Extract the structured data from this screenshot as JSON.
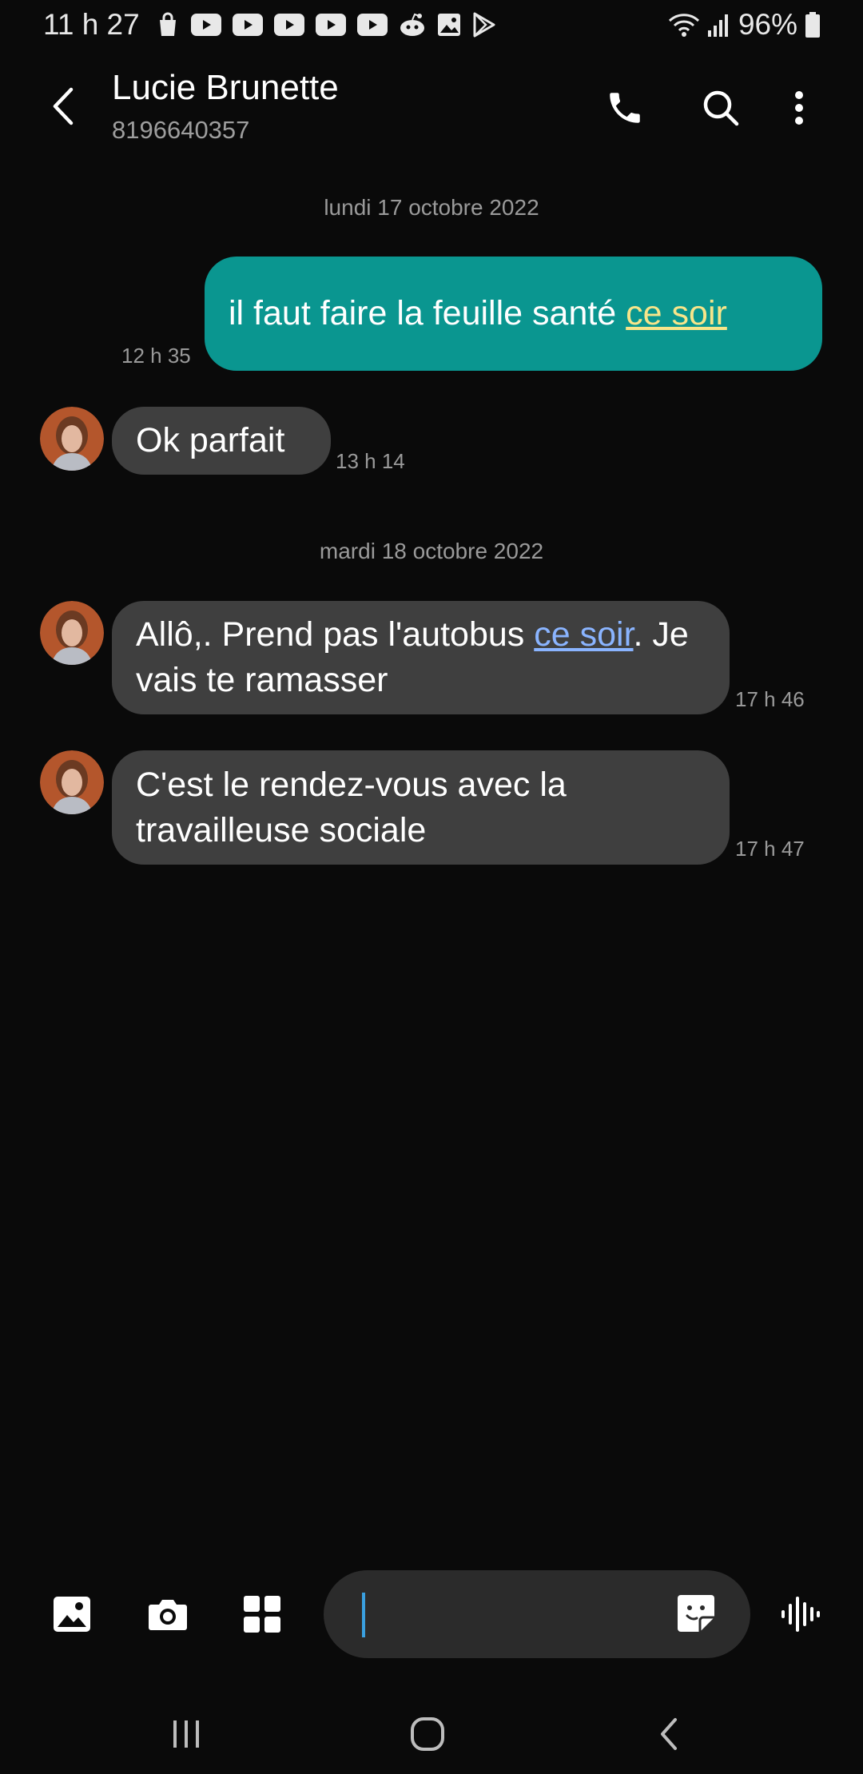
{
  "status_bar": {
    "time": "11 h 27",
    "battery": "96%",
    "notification_icons": [
      "shopping-bag-icon",
      "youtube-icon",
      "youtube-icon",
      "youtube-icon",
      "youtube-icon",
      "youtube-icon",
      "reddit-icon",
      "gallery-icon",
      "play-store-icon"
    ]
  },
  "header": {
    "contact_name": "Lucie Brunette",
    "contact_number": "8196640357"
  },
  "conversation": {
    "date_1": "lundi 17 octobre 2022",
    "msg_1": {
      "text_before": "il faut faire la feuille santé ",
      "link": "ce soir",
      "time": "12 h 35"
    },
    "msg_2": {
      "text": "Ok parfait",
      "time": "13 h 14"
    },
    "date_2": "mardi 18 octobre 2022",
    "msg_3": {
      "text_before": "Allô,. Prend pas l'autobus ",
      "link": "ce soir",
      "text_after": ".  Je vais te ramasser",
      "time": "17 h 46"
    },
    "msg_4": {
      "text": "C'est le rendez-vous avec la travailleuse sociale",
      "time": "17 h 47"
    }
  },
  "colors": {
    "background": "#0a0a0a",
    "outgoing_bubble": "#0a9690",
    "incoming_bubble": "#3f3f3f",
    "outgoing_link": "#f7e58a",
    "incoming_link": "#8ab4ff",
    "cursor": "#3aa0e0"
  }
}
